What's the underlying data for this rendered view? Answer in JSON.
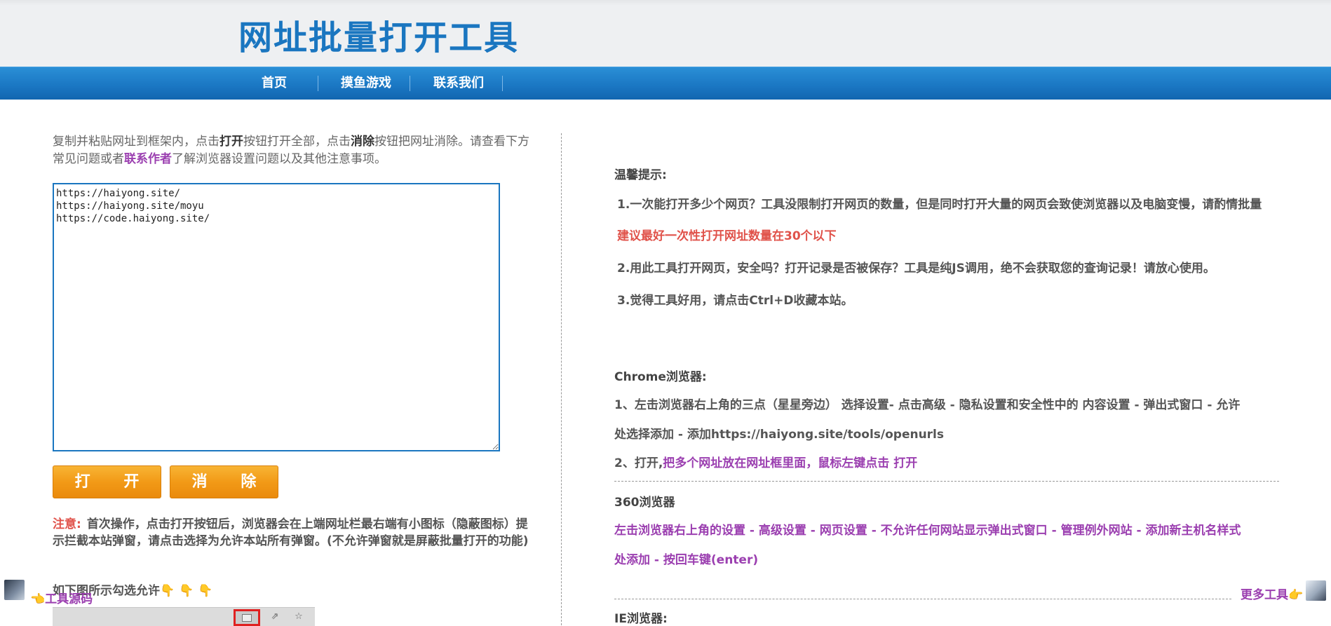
{
  "header": {
    "title": "网址批量打开工具"
  },
  "nav": {
    "items": [
      {
        "label": "首页"
      },
      {
        "label": "摸鱼游戏"
      },
      {
        "label": "联系我们"
      }
    ]
  },
  "left": {
    "intro_part1": "复制并粘贴网址到框架内，点击",
    "intro_open": "打开",
    "intro_part2": "按钮打开全部，点击",
    "intro_clear": "消除",
    "intro_part3": "按钮把网址消除。请查看下方常见问题或者",
    "intro_contact": "联系作者",
    "intro_part4": "了解浏览器设置问题以及其他注意事项。",
    "textarea_value": "https://haiyong.site/\nhttps://haiyong.site/moyu\nhttps://code.haiyong.site/",
    "open_button": "打 开",
    "clear_button": "消 除",
    "note_label": "注意:",
    "note_text": "首次操作，点击打开按钮后，浏览器会在上端网址栏最右端有小图标（隐蔽图标）提示拦截本站弹窗，请点击选择为允许本站所有弹窗。(不允许弹窗就是屏蔽批量打开的功能)",
    "below_text": "如下图所示勾选允许👇 👇 👇",
    "source_badge": "👈工具源码"
  },
  "right": {
    "tips_heading": "温馨提示:",
    "tip1": "1.一次能打开多少个网页？工具没限制打开网页的数量，但是同时打开大量的网页会致使浏览器以及电脑变慢，请酌情批量",
    "tip1_red": "建议最好一次性打开网址数量在30个以下",
    "tip2": "2.用此工具打开网页，安全吗？打开记录是否被保存？工具是纯JS调用，绝不会获取您的查询记录！请放心使用。",
    "tip3": "3.觉得工具好用，请点击Ctrl+D收藏本站。",
    "chrome_heading": "Chrome浏览器:",
    "chrome_step1a": "1、左击浏览器右上角的三点（星星旁边） 选择设置- 点击高级 - 隐私设置和安全性中的 内容设置 - 弹出式窗口 - 允许",
    "chrome_step1b": "处选择添加 - 添加https://haiyong.site/tools/openurls",
    "chrome_step2_prefix": "2、打开,",
    "chrome_step2_purple": "把多个网址放在网址框里面，鼠标左键点击 打开",
    "b360_heading": "360浏览器",
    "b360_step_a": "左击浏览器右上角的设置 - 高级设置 - 网页设置 - 不允许任何网站显示弹出式窗口 - 管理例外网站 - 添加新主机名样式",
    "b360_step_b": "处添加 - 按回车键(enter)",
    "ie_heading": "IE浏览器:",
    "more_tools": "更多工具👉"
  },
  "colors": {
    "title_blue": "#1a76c0",
    "nav_blue": "#1b78c4",
    "button_orange": "#f29a17",
    "warn_red": "#e0524a",
    "link_purple": "#9b3fb0"
  }
}
